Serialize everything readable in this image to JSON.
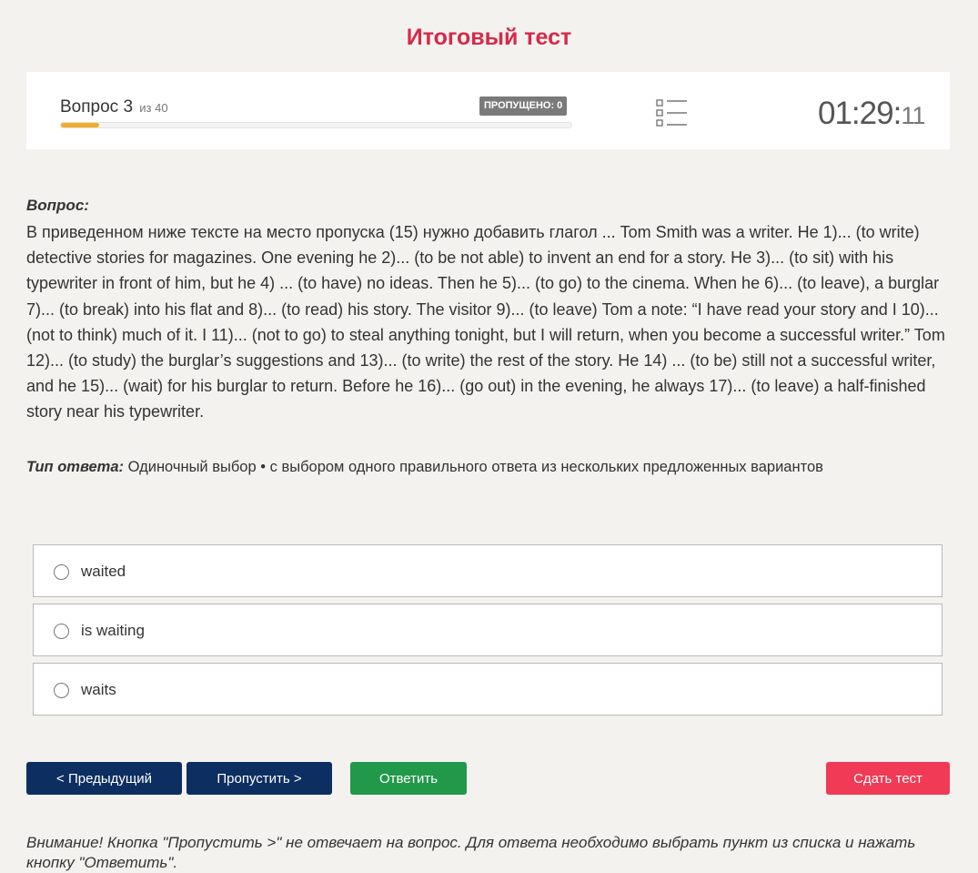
{
  "header": {
    "title": "Итоговый тест"
  },
  "status": {
    "question_label": "Вопрос 3",
    "question_of": "из 40",
    "skipped": "ПРОПУЩЕНО: 0",
    "progress_fraction": 0.075,
    "timer_main": "01:29:",
    "timer_seconds": "11",
    "list_icon": "list-icon"
  },
  "question": {
    "label": "Вопрос:",
    "text": "В приведенном ниже тексте на место пропуска (15) нужно добавить глагол ... Tom Smith was a writer. He 1)... (to write) detective stories for magazines. One evening he 2)... (to be not able) to invent an end for a story. He 3)... (to sit) with his typewriter in front of him, but he 4) ... (to have) no ideas. Then he 5)... (to go) to the cinema. When he 6)... (to leave), a burglar 7)... (to break) into his flat and 8)... (to read) his story. The visitor 9)... (to leave) Tom a note: “I have read your story and I 10)... (not to think) much of it. I 11)... (not to go) to steal anything tonight, but I will return, when you become a successful writer.” Tom 12)... (to study) the burglar’s suggestions and 13)... (to write) the rest of the story. He 14) ... (to be) still not a successful writer, and he 15)... (wait) for his burglar to return. Before he 16)... (go out) in the evening, he always 17)... (to leave) a half-finished story near his typewriter."
  },
  "answer_type": {
    "label": "Тип ответа:",
    "value": "Одиночный выбор • с выбором одного правильного ответа из нескольких предложенных вариантов"
  },
  "options": [
    {
      "label": "waited"
    },
    {
      "label": "is waiting"
    },
    {
      "label": "waits"
    }
  ],
  "buttons": {
    "prev": "< Предыдущий",
    "skip": "Пропустить >",
    "answer": "Ответить",
    "submit": "Сдать тест"
  },
  "warning": "Внимание! Кнопка \"Пропустить >\" не отвечает на вопрос. Для ответа необходимо выбрать пункт из списка и нажать кнопку \"Ответить\"."
}
